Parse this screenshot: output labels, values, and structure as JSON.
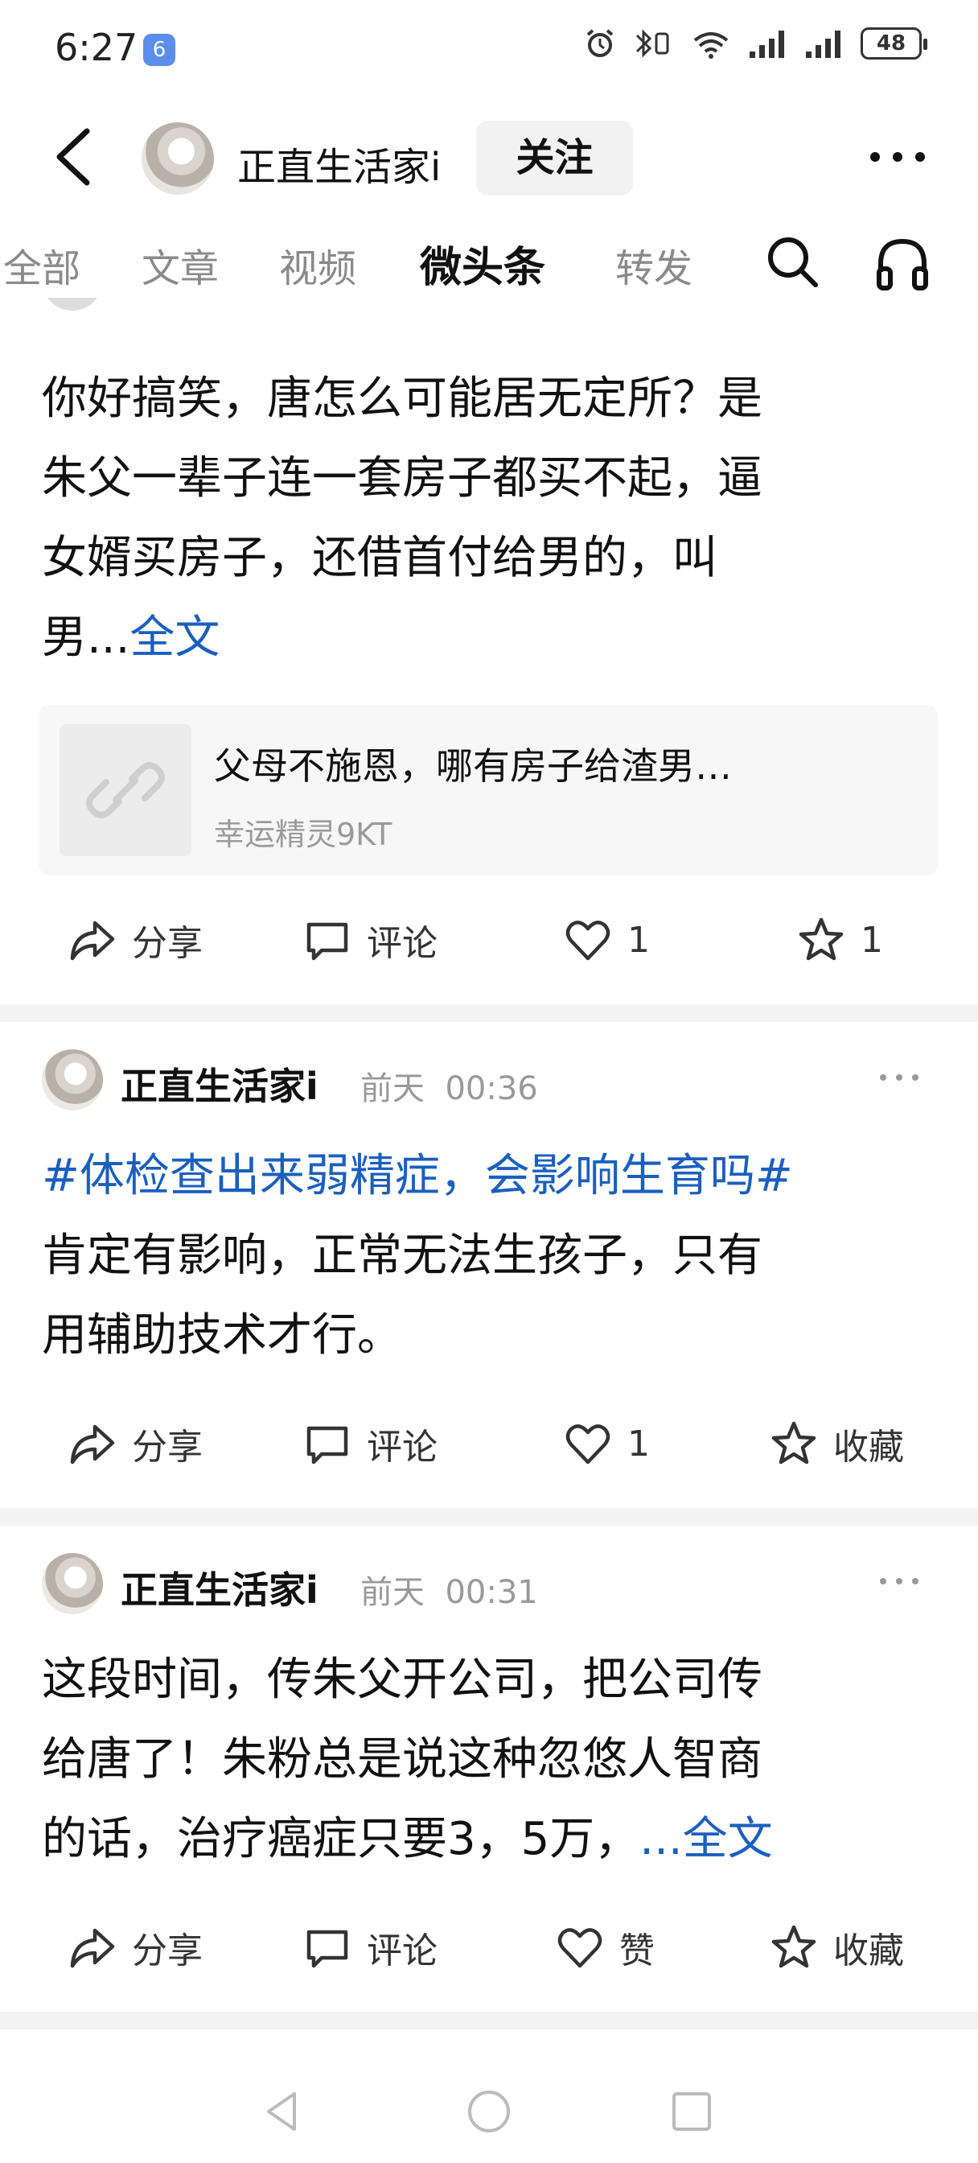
{
  "status_bar": {
    "time": "6:27",
    "app_badge": "6",
    "battery": "48"
  },
  "header": {
    "profile_name": "正直生活家i",
    "follow_label": "关注"
  },
  "tabs": [
    {
      "label": "全部",
      "active": false
    },
    {
      "label": "文章",
      "active": false
    },
    {
      "label": "视频",
      "active": false
    },
    {
      "label": "微头条",
      "active": true
    },
    {
      "label": "转发",
      "active": false
    }
  ],
  "posts": [
    {
      "text_lines": [
        "你好搞笑，唐怎么可能居无定所？是",
        "朱父一辈子连一套房子都买不起，逼",
        "女婿买房子，还借首付给男的，叫"
      ],
      "last_line": "男...",
      "more_link": "全文",
      "card": {
        "title": "父母不施恩，哪有房子给渣男…",
        "source": "幸运精灵9KT"
      },
      "actions": {
        "share": "分享",
        "comment": "评论",
        "like": "1",
        "favorite": "1"
      }
    },
    {
      "author": "正直生活家i",
      "day": "前天",
      "time": "00:36",
      "topic": "#体检查出来弱精症，会影响生育吗#",
      "text_lines": [
        "肯定有影响，正常无法生孩子，只有",
        "用辅助技术才行。"
      ],
      "actions": {
        "share": "分享",
        "comment": "评论",
        "like": "1",
        "favorite": "收藏"
      }
    },
    {
      "author": "正直生活家i",
      "day": "前天",
      "time": "00:31",
      "text_lines": [
        "这段时间，传朱父开公司，把公司传",
        "给唐了！朱粉总是说这种忽悠人智商"
      ],
      "last_line": "的话，治疗癌症只要3，5万，",
      "more_link": "...全文",
      "actions": {
        "share": "分享",
        "comment": "评论",
        "like": "赞",
        "favorite": "收藏"
      }
    }
  ],
  "icons": {
    "back": "chevron-left-icon",
    "more": "more-dots-icon",
    "search": "search-icon",
    "listen": "headphones-icon",
    "share": "share-arrow-icon",
    "comment": "comment-bubble-icon",
    "like": "heart-icon",
    "favorite": "star-icon",
    "link": "link-icon"
  },
  "colors": {
    "link_blue": "#1a5fc0",
    "divider": "#f4f4f4"
  }
}
